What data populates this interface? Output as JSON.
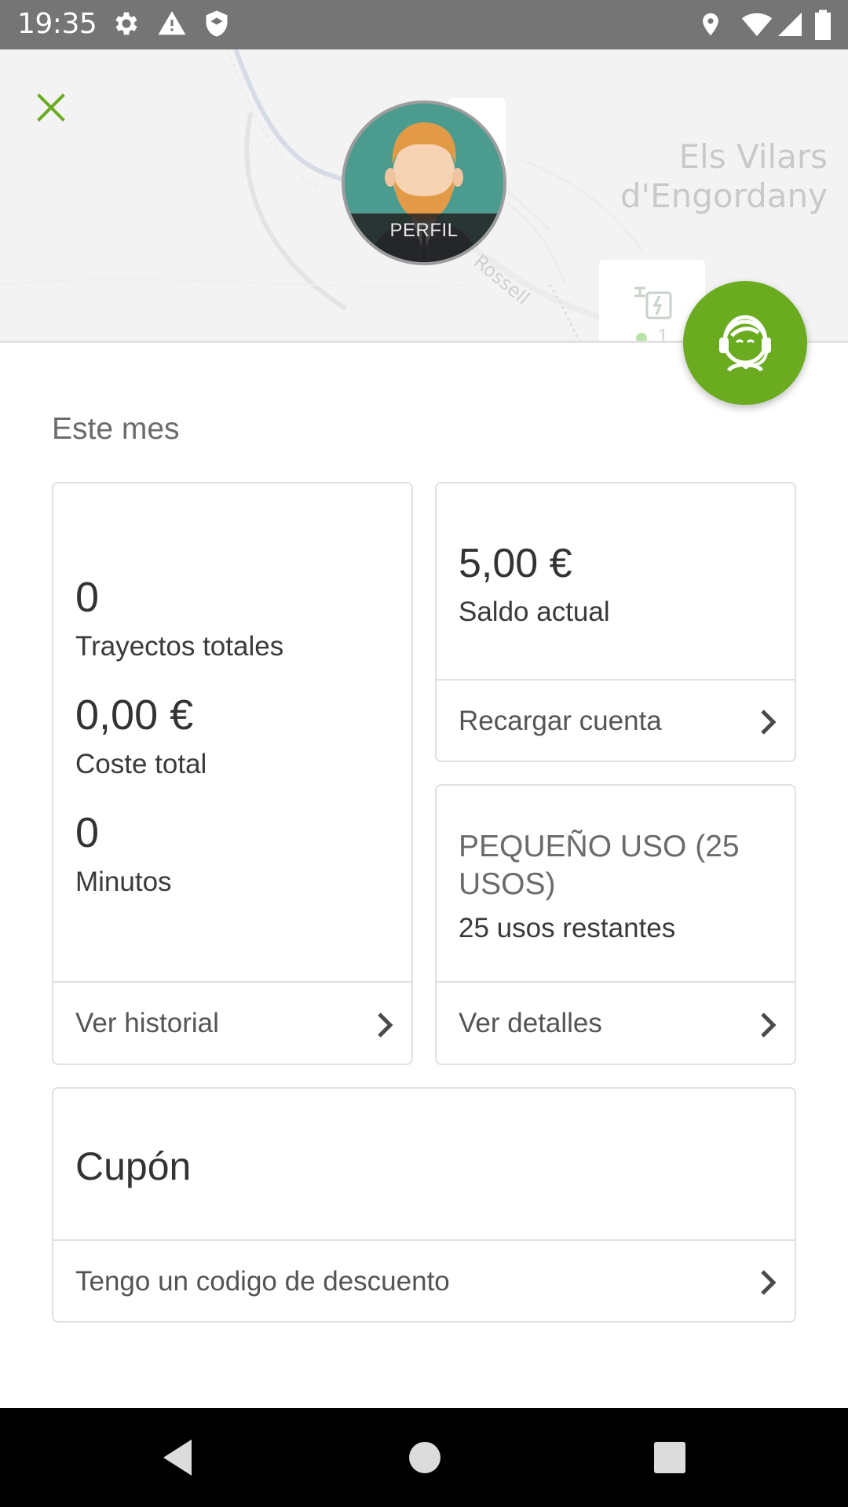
{
  "status_bar": {
    "time": "19:35",
    "left_icons": [
      "gear-icon",
      "warning-icon",
      "shield-icon"
    ],
    "right_icons": [
      "location-icon",
      "wifi-icon",
      "signal-icon",
      "battery-icon"
    ]
  },
  "map": {
    "place_name_line1": "Els Vilars",
    "place_name_line2": "d'Engordany",
    "street_name": "Rossell",
    "poi_count": "1"
  },
  "header": {
    "close_icon": "close-icon",
    "profile_label": "PERFIL",
    "support_icon": "support-agent-icon"
  },
  "main": {
    "section_title": "Este mes",
    "stats_card": {
      "trips_value": "0",
      "trips_label": "Trayectos totales",
      "cost_value": "0,00 €",
      "cost_label": "Coste total",
      "minutes_value": "0",
      "minutes_label": "Minutos",
      "history_label": "Ver historial"
    },
    "balance_card": {
      "balance_value": "5,00 €",
      "balance_label": "Saldo actual",
      "recharge_label": "Recargar cuenta"
    },
    "plan_card": {
      "plan_name": "PEQUEÑO USO (25 USOS)",
      "remaining": "25 usos restantes",
      "details_label": "Ver detalles"
    },
    "coupon_card": {
      "title": "Cupón",
      "discount_label": "Tengo un codigo de descuento"
    }
  },
  "colors": {
    "accent": "#6aab1f",
    "status_bar": "#757575",
    "nav_bar": "#000000"
  }
}
